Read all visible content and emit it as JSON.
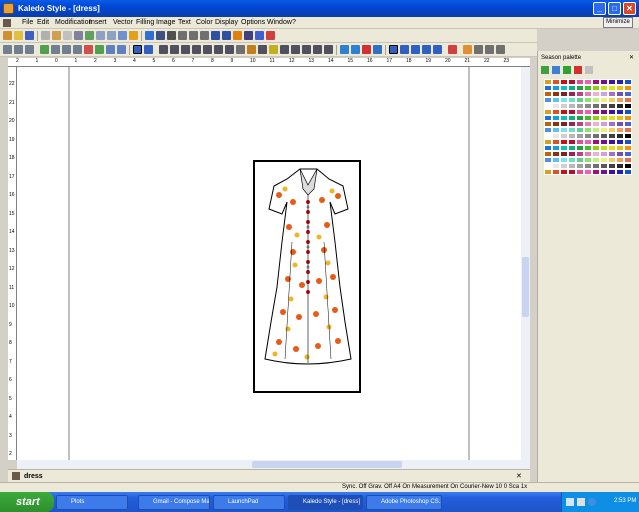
{
  "window": {
    "title": "Kaledo Style - [dress]",
    "minimize_label": "Minimize"
  },
  "menu": [
    "File",
    "Edit",
    "Modification",
    "Insert",
    "Vector",
    "Filling",
    "Image",
    "Text",
    "Color",
    "Display",
    "Options",
    "Window",
    "?"
  ],
  "rulers": {
    "top": [
      "2",
      "1",
      "0",
      "1",
      "2",
      "3",
      "4",
      "5",
      "6",
      "7",
      "8",
      "9",
      "10",
      "11",
      "12",
      "13",
      "14",
      "15",
      "16",
      "17",
      "18",
      "19",
      "20",
      "21",
      "22",
      "23"
    ],
    "left": [
      "22",
      "21",
      "20",
      "19",
      "18",
      "17",
      "16",
      "15",
      "14",
      "13",
      "12",
      "11",
      "10",
      "9",
      "8",
      "7",
      "6",
      "5",
      "4",
      "3",
      "2"
    ]
  },
  "document_tab": "dress",
  "status": {
    "items": "Sync. Off   Grav. Off   A4 On   Measurement On   Courier-New 10   0   Sca 1x"
  },
  "palette": {
    "title": "Season palette",
    "colors": [
      "#d8a020",
      "#e05020",
      "#c81010",
      "#b01030",
      "#e05090",
      "#f060b0",
      "#a01070",
      "#701090",
      "#4010a0",
      "#2020c0",
      "#1850d0",
      "#2070e0",
      "#10a0e0",
      "#10c0c0",
      "#10b080",
      "#20a040",
      "#40c020",
      "#90d010",
      "#c0e020",
      "#e0e020",
      "#f0c010",
      "#f09010",
      "#c06010",
      "#903010",
      "#802020",
      "#a02050",
      "#c04080",
      "#e080b0",
      "#f0b0d0",
      "#d0a0e0",
      "#a070d0",
      "#7050c0",
      "#5060d0",
      "#5090e0",
      "#60c0f0",
      "#80e0f0",
      "#70e0c0",
      "#60d090",
      "#90e070",
      "#c0f080",
      "#f0f080",
      "#f0d060",
      "#f0a060",
      "#e07050",
      "#ffffff",
      "#e8e8e8",
      "#d0d0d0",
      "#b8b8b8",
      "#a0a0a0",
      "#888888",
      "#707070",
      "#585858",
      "#404040",
      "#282828",
      "#000000"
    ]
  },
  "taskbar": {
    "start": "start",
    "tasks": [
      "Plots",
      "Gmail - Compose Mail ...",
      "LaunchPad",
      "Kaledo Style - [dress]",
      "Adobe Photoshop CS..."
    ],
    "clock": "2:53 PM"
  }
}
